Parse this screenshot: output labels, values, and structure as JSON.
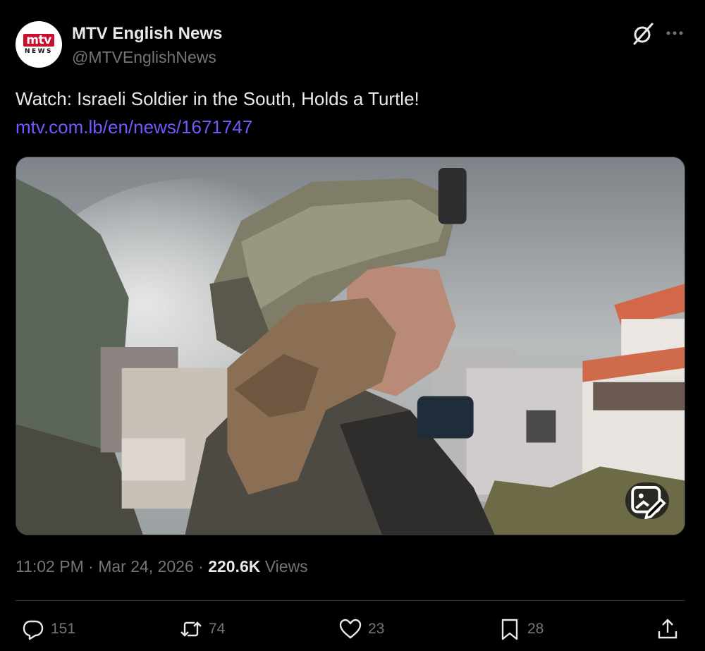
{
  "author": {
    "name": "MTV English News",
    "handle": "@MTVEnglishNews",
    "logo_text_top": "mtv",
    "logo_text_bottom": "NEWS"
  },
  "tweet": {
    "text": "Watch: Israeli Soldier in the South, Holds a Turtle!",
    "link": "mtv.com.lb/en/news/1671747"
  },
  "meta": {
    "time": "11:02 PM",
    "separator": "·",
    "date": "Mar 24, 2026",
    "views_count": "220.6K",
    "views_label": "Views"
  },
  "actions": {
    "replies": "151",
    "reposts": "74",
    "likes": "23",
    "bookmarks": "28"
  },
  "icons": {
    "more": "more-icon",
    "grok": "grok-icon",
    "gif": "gif-icon",
    "reply": "reply-icon",
    "repost": "repost-icon",
    "like": "heart-icon",
    "bookmark": "bookmark-icon",
    "share": "share-icon"
  },
  "colors": {
    "background": "#000000",
    "text": "#e7e9ea",
    "muted": "#71767b",
    "link": "#7856ff",
    "divider": "#2f3336",
    "logo_red": "#c8102e"
  }
}
